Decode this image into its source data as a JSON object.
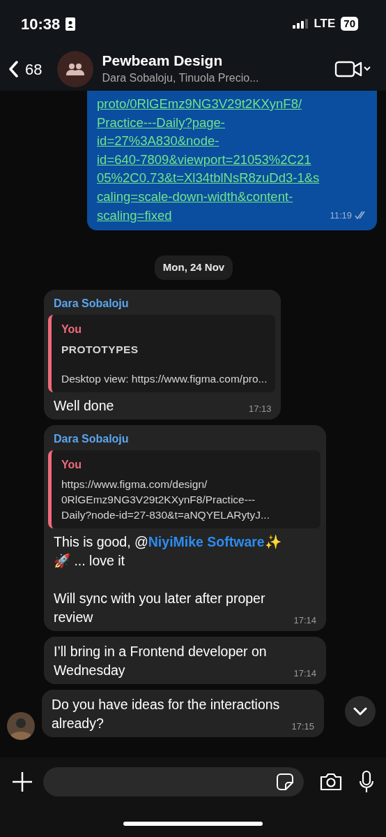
{
  "status_bar": {
    "time": "10:38",
    "network": "LTE",
    "battery": "70"
  },
  "header": {
    "back_count": "68",
    "title": "Pewbeam Design",
    "subtitle": "Dara Sobaloju, Tinuola Precio..."
  },
  "messages": [
    {
      "kind": "outgoing",
      "link_lines": [
        "proto/0RlGEmz9NG3V29t2KXynF8/",
        "Practice---Daily?page-",
        "id=27%3A830&node-",
        "id=640-7809&viewport=21053%2C21",
        "05%2C0.73&t=Xl34tblNsR8zuDd3-1&s",
        "caling=scale-down-width&content-",
        "scaling=fixed"
      ],
      "time": "11:19",
      "read": true
    },
    {
      "kind": "date",
      "text": "Mon, 24 Nov"
    },
    {
      "kind": "incoming",
      "sender": "Dara Sobaloju",
      "quote": {
        "author": "You",
        "title": "PROTOTYPES",
        "lines": [
          "Desktop view: https://www.figma.com/pro..."
        ]
      },
      "parts": [
        {
          "kind": "text",
          "text": "Well done"
        }
      ],
      "time": "17:13"
    },
    {
      "kind": "incoming",
      "sender": "Dara Sobaloju",
      "quote": {
        "author": "You",
        "lines": [
          "https://www.figma.com/design/",
          "0RlGEmz9NG3V29t2KXynF8/Practice---",
          "Daily?node-id=27-830&t=aNQYELARytyJ..."
        ]
      },
      "parts": [
        {
          "kind": "text",
          "text": "This is good, @"
        },
        {
          "kind": "mention",
          "text": "NiyiMike Software"
        },
        {
          "kind": "text",
          "text": "✨\n🚀 ... love it\n\nWill sync with you later after proper review"
        }
      ],
      "time": "17:14"
    },
    {
      "kind": "incoming",
      "parts": [
        {
          "kind": "text",
          "text": "I’ll bring in a Frontend developer on Wednesday"
        }
      ],
      "time": "17:14"
    },
    {
      "kind": "incoming",
      "avatar": true,
      "parts": [
        {
          "kind": "text",
          "text": "Do you have ideas for the interactions already?"
        }
      ],
      "time": "17:15"
    }
  ]
}
